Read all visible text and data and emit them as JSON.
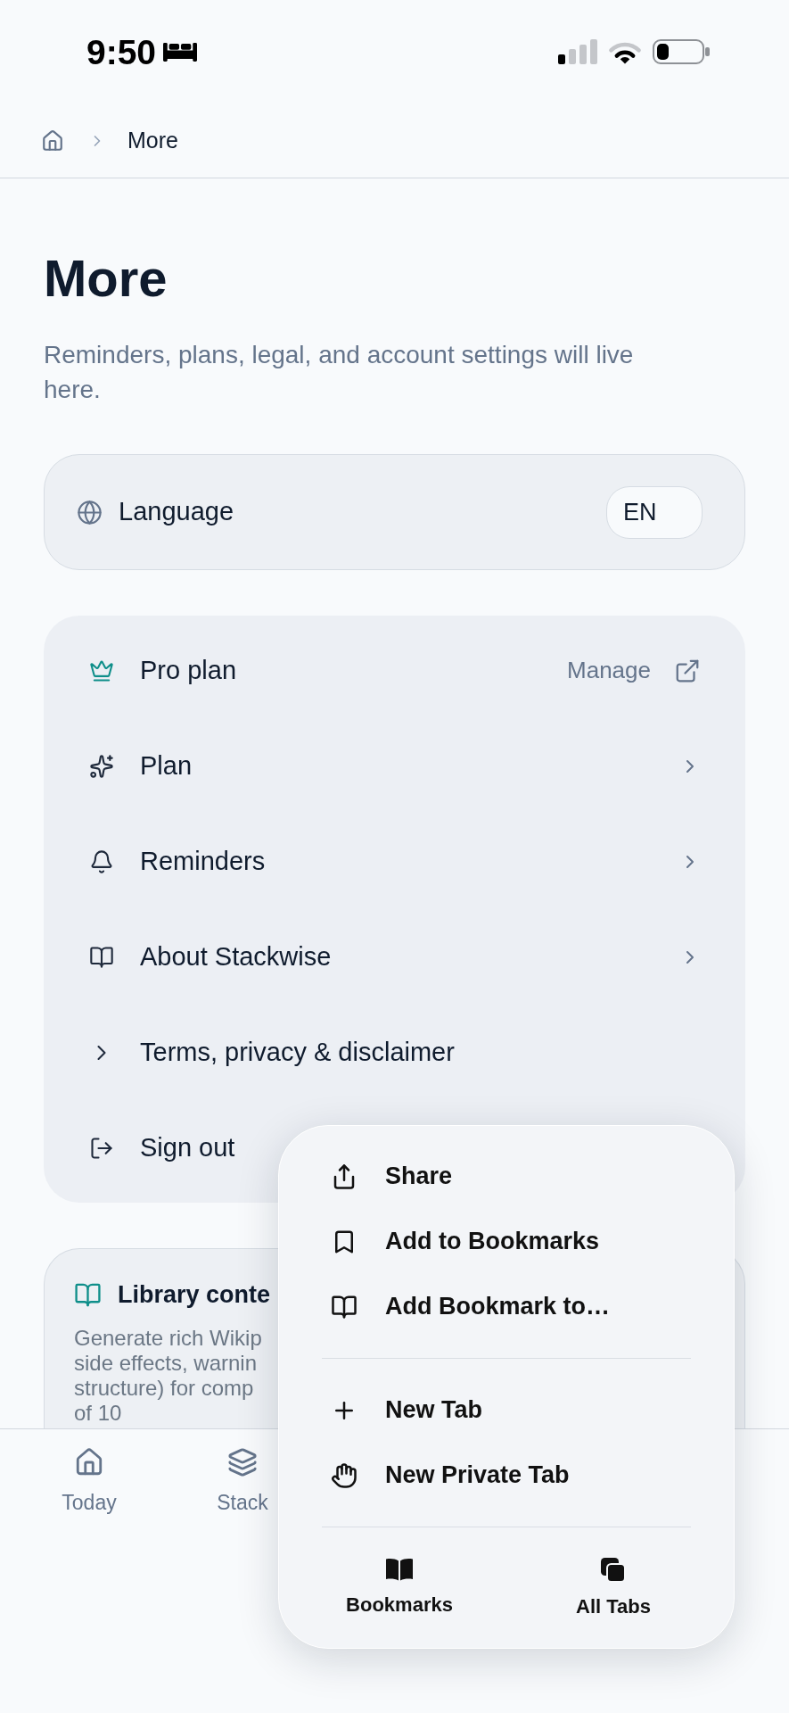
{
  "status_bar": {
    "time": "9:50"
  },
  "breadcrumb": {
    "current": "More"
  },
  "header": {
    "title": "More",
    "subtitle": "Reminders, plans, legal, and account settings will live here."
  },
  "language_card": {
    "label": "Language",
    "value": "EN"
  },
  "menu": [
    {
      "kind": "plan",
      "label": "Pro plan",
      "action": "Manage"
    },
    {
      "kind": "link",
      "label": "Plan"
    },
    {
      "kind": "link",
      "label": "Reminders"
    },
    {
      "kind": "link",
      "label": "About Stackwise"
    },
    {
      "kind": "disclosure",
      "label": "Terms, privacy & disclaimer"
    },
    {
      "kind": "action",
      "label": "Sign out"
    }
  ],
  "library_card": {
    "title": "Library conte",
    "description_lines": [
      "Generate rich Wikip",
      "side effects, warnin",
      "structure) for comp",
      "of 10"
    ]
  },
  "bottom_nav": [
    {
      "label": "Today",
      "selected": false
    },
    {
      "label": "Stack",
      "selected": false
    }
  ],
  "popup_menu": {
    "groups": [
      {
        "items": [
          {
            "label": "Share"
          },
          {
            "label": "Add to Bookmarks"
          },
          {
            "label": "Add Bookmark to…"
          }
        ]
      },
      {
        "items": [
          {
            "label": "New Tab"
          },
          {
            "label": "New Private Tab"
          }
        ]
      }
    ],
    "tabs": [
      {
        "label": "Bookmarks"
      },
      {
        "label": "All Tabs"
      }
    ]
  }
}
